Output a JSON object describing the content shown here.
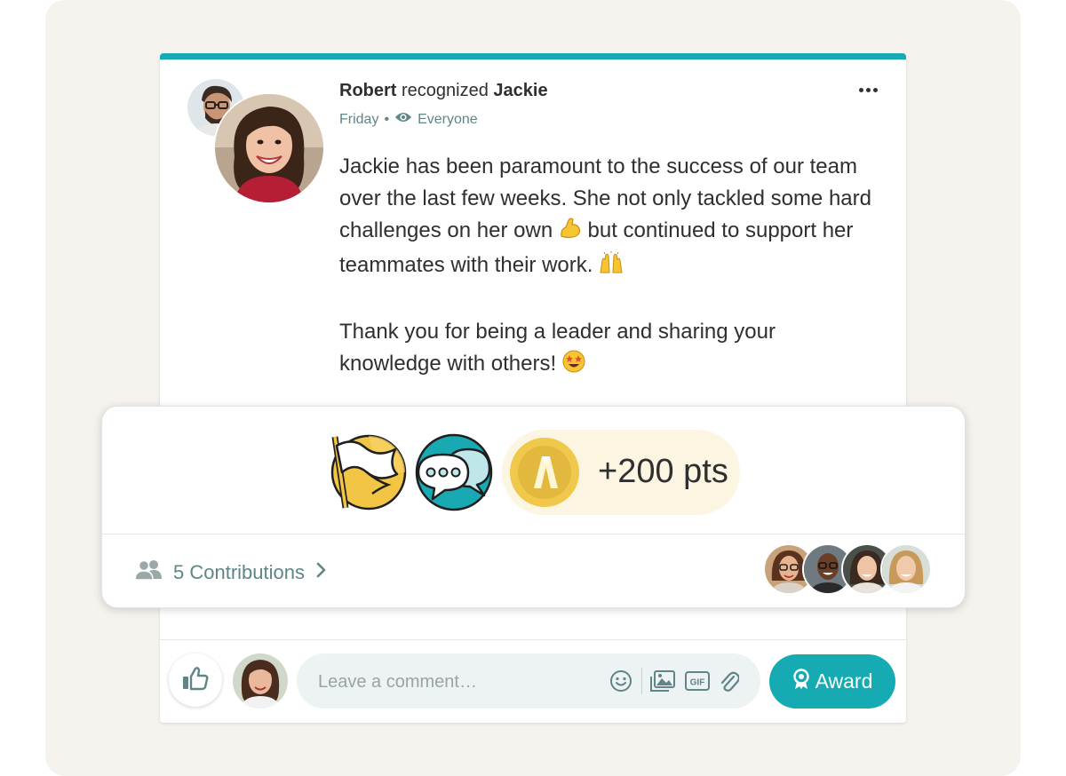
{
  "post": {
    "author": "Robert",
    "action": "recognized",
    "recipient": "Jackie",
    "day": "Friday",
    "separator": "•",
    "audience": "Everyone",
    "message_lines_1": "Jackie has been paramount to the success of our team over the last few weeks. She not only tackled some hard challenges on her own",
    "message_lines_1b": "but continued to support her teammates with their work.",
    "message_2": "Thank you for being a leader and sharing your knowledge with others!",
    "emojis": [
      "flexed-biceps",
      "raising-hands",
      "star-struck"
    ]
  },
  "award": {
    "badges": [
      "flag-badge-icon",
      "chat-bubbles-badge-icon"
    ],
    "points": "+200 pts",
    "contributions_label": "5 Contributions"
  },
  "composer": {
    "comment_placeholder": "Leave a comment…",
    "gif_label": "GIF",
    "award_button": "Award"
  },
  "colors": {
    "accent": "#16aab2",
    "background_panel": "#f6f2ee",
    "muted_teal_text": "#5f8587",
    "points_pill": "#fcf5e1",
    "coin_gold": "#f0c84b"
  }
}
